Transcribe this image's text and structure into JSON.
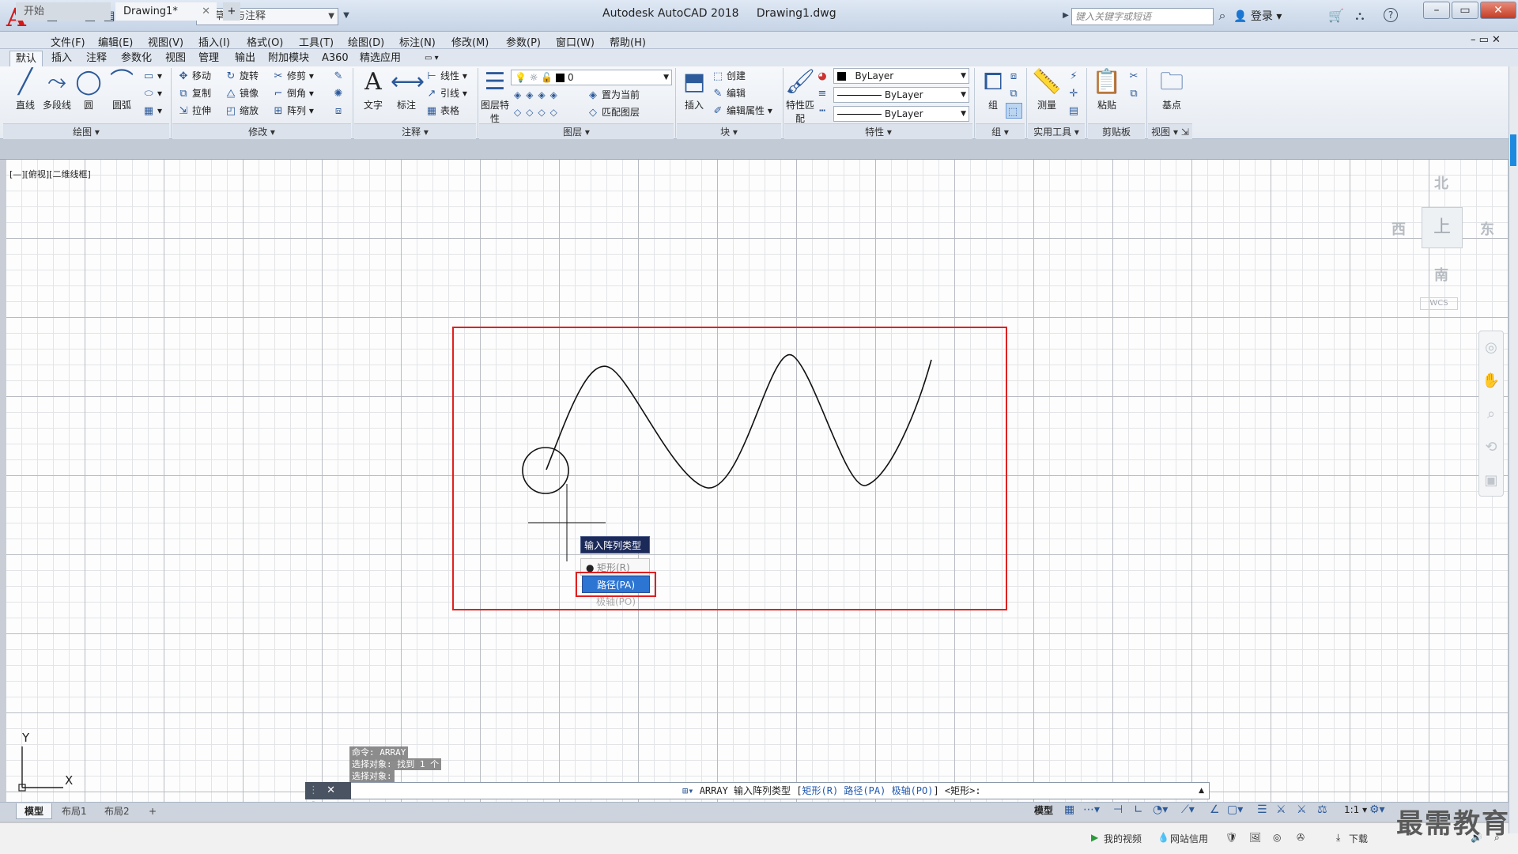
{
  "app": {
    "title": "Autodesk AutoCAD 2018",
    "document": "Drawing1.dwg",
    "logo": "A",
    "workspace": "草图与注释",
    "search_placeholder": "键入关键字或短语",
    "login": "登录",
    "help": "?"
  },
  "menubar": [
    "文件(F)",
    "编辑(E)",
    "视图(V)",
    "插入(I)",
    "格式(O)",
    "工具(T)",
    "绘图(D)",
    "标注(N)",
    "修改(M)",
    "参数(P)",
    "窗口(W)",
    "帮助(H)"
  ],
  "ribbon_tabs": [
    "默认",
    "插入",
    "注释",
    "参数化",
    "视图",
    "管理",
    "输出",
    "附加模块",
    "A360",
    "精选应用"
  ],
  "ribbon": {
    "draw": {
      "label": "绘图",
      "line": "直线",
      "polyline": "多段线",
      "circle": "圆",
      "arc": "圆弧"
    },
    "modify": {
      "label": "修改",
      "move": "移动",
      "rotate": "旋转",
      "trim": "修剪",
      "copy": "复制",
      "mirror": "镜像",
      "fillet": "倒角",
      "stretch": "拉伸",
      "scale": "缩放",
      "array": "阵列"
    },
    "annotation": {
      "label": "注释",
      "text": "文字",
      "dimension": "标注",
      "linear": "线性",
      "leader": "引线",
      "table": "表格"
    },
    "layers": {
      "label": "图层",
      "props": "图层特性",
      "current_layer": "0",
      "set_current": "置为当前",
      "match": "匹配图层"
    },
    "block": {
      "label": "块",
      "insert": "插入",
      "create": "创建",
      "edit": "编辑",
      "edit_attr": "编辑属性"
    },
    "properties": {
      "label": "特性",
      "match": "特性匹配",
      "color": "ByLayer",
      "linetype": "ByLayer",
      "lineweight": "ByLayer"
    },
    "groups": {
      "label": "组",
      "group": "组"
    },
    "utilities": {
      "label": "实用工具",
      "measure": "测量"
    },
    "clipboard": {
      "label": "剪贴板",
      "paste": "粘贴"
    },
    "view": {
      "label": "视图",
      "base": "基点"
    }
  },
  "file_tabs": {
    "start": "开始",
    "drawing": "Drawing1*"
  },
  "viewport_label": "[—][俯视][二维线框]",
  "viewcube": {
    "north": "北",
    "south": "南",
    "east": "东",
    "west": "西",
    "wcs": "WCS"
  },
  "dynamic_input": {
    "prompt": "输入阵列类型",
    "options": [
      "矩形(R)",
      "路径(PA)",
      "极轴(PO)"
    ],
    "selected": "路径(PA)"
  },
  "ucs": {
    "x": "X",
    "y": "Y"
  },
  "command_history": [
    "命令: ARRAY",
    "选择对象: 找到 1 个",
    "选择对象:"
  ],
  "command_line": {
    "prefix": "ARRAY 输入阵列类型 [",
    "opt1": "矩形(R)",
    "opt2": "路径(PA)",
    "opt3": "极轴(PO)",
    "suffix": "] <矩形>:"
  },
  "layout_tabs": [
    "模型",
    "布局1",
    "布局2"
  ],
  "status": {
    "model": "模型",
    "scale": "1:1"
  },
  "taskbar": {
    "video": "我的视频",
    "net": "网站信用",
    "download": "下载"
  },
  "watermark": "最需教育"
}
